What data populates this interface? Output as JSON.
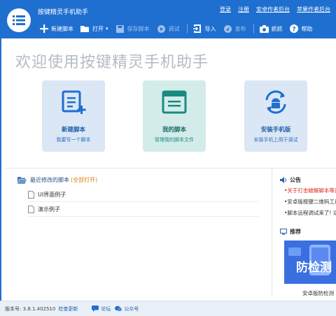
{
  "app": {
    "title": "按键精灵手机助手",
    "logo_icon": "list-icon"
  },
  "top_links": [
    "登录",
    "注册",
    "安卓作者后台",
    "苹果作者后台"
  ],
  "toolbar": {
    "new_script": "新建脚本",
    "open": "打开",
    "save": "保存脚本",
    "debug": "调试",
    "import": "导入",
    "publish": "发布",
    "capture": "抓抓",
    "help": "帮助"
  },
  "welcome": "欢迎使用按键精灵手机助手",
  "tiles": [
    {
      "title": "新建脚本",
      "subtitle": "我要写一个脚本",
      "icon": "new-file-icon"
    },
    {
      "title": "我的脚本",
      "subtitle": "管理我的脚本文件",
      "icon": "script-window-icon"
    },
    {
      "title": "安装手机版",
      "subtitle": "安装手机上用于调试",
      "icon": "android-sync-icon"
    }
  ],
  "recent": {
    "title": "最近修改的脚本",
    "open_all": "(全部打开)",
    "items": [
      "UI界面例子",
      "演示例子"
    ]
  },
  "notice": {
    "title": "公告",
    "items": [
      "•关于打击破解脚本等违",
      "•安卓版按键二维码工具",
      "•脚本远程调试来了! 适"
    ]
  },
  "recommend": {
    "title": "推荐",
    "banner_text": "防检测",
    "caption": "安卓版防检测"
  },
  "status": {
    "version": "版本号: 3.8.1.402510",
    "check_update": "检查更新",
    "forum": "论坛",
    "wechat": "公众号"
  },
  "colors": {
    "brand": "#1f6fd0",
    "accent_orange": "#e07c17",
    "notice_red": "#e0241b"
  }
}
